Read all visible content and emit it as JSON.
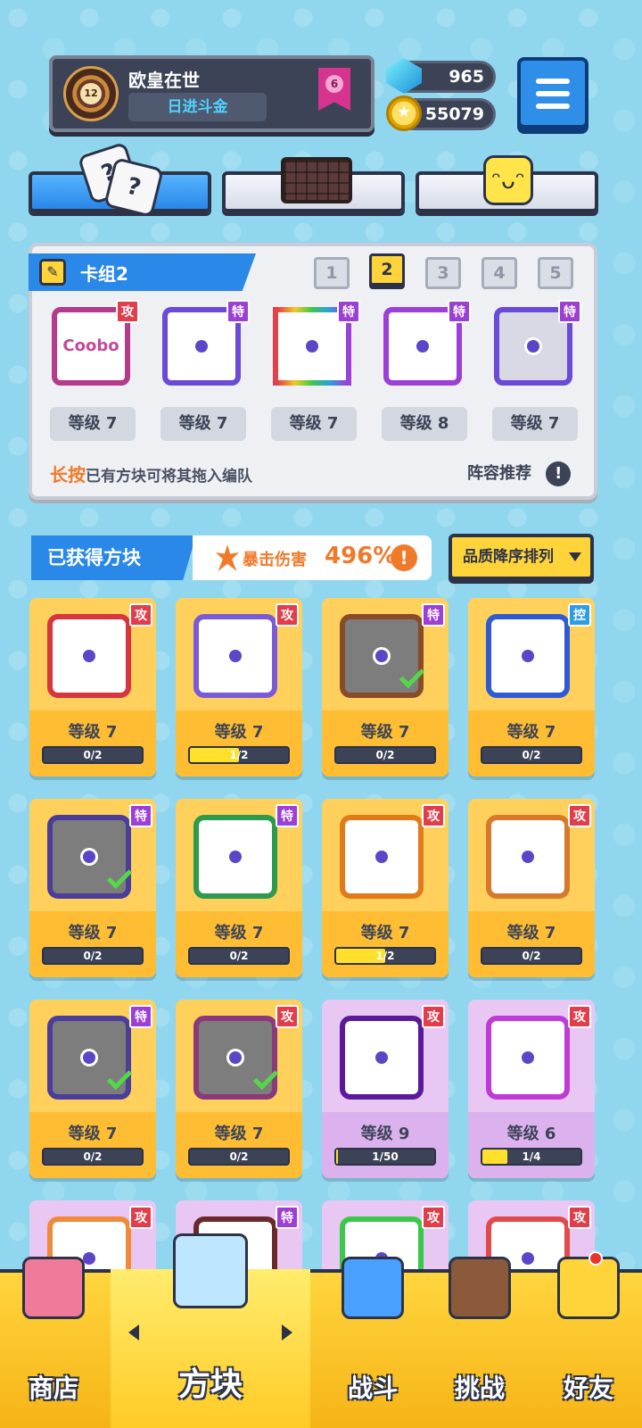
{
  "player": {
    "name": "欧皇在世",
    "title": "日进斗金",
    "rank_level": "12",
    "vip_level": "6"
  },
  "currency": {
    "gems": "965",
    "coins": "55079"
  },
  "icons": {
    "menu": "hamburger-menu-icon",
    "gem": "blue-gem-icon",
    "coin": "gold-coin-icon"
  },
  "top_tabs": [
    {
      "icon": "dice-icon",
      "active": true
    },
    {
      "icon": "grid-board-icon",
      "active": false
    },
    {
      "icon": "smiley-block-icon",
      "active": false
    }
  ],
  "deck": {
    "title": "卡组2",
    "pages": [
      "1",
      "2",
      "3",
      "4",
      "5"
    ],
    "active_page": "2",
    "cards": [
      {
        "tag": "攻",
        "level": "等级 7",
        "inner": "Coobo"
      },
      {
        "tag": "特",
        "level": "等级 7",
        "inner": ""
      },
      {
        "tag": "特",
        "level": "等级 7",
        "inner": ""
      },
      {
        "tag": "特",
        "level": "等级 8",
        "inner": ""
      },
      {
        "tag": "特",
        "level": "等级 7",
        "inner": ""
      }
    ],
    "hint_highlight": "长按",
    "hint_text": "已有方块可将其拖入编队",
    "recommend": "阵容推荐",
    "info": "!"
  },
  "owned": {
    "title": "已获得方块",
    "crit_label": "暴击伤害",
    "crit_value": "496%",
    "warn": "!",
    "sort_label": "品质降序排列",
    "cards": [
      {
        "tag": "攻",
        "level": "等级 7",
        "progress": "0/2",
        "fill": 0,
        "frame": "#d8353f",
        "style": "gold",
        "check": false
      },
      {
        "tag": "攻",
        "level": "等级 7",
        "progress": "1/2",
        "fill": 0.5,
        "frame": "#7a5ad6",
        "style": "gold",
        "check": false
      },
      {
        "tag": "特",
        "level": "等级 7",
        "progress": "0/2",
        "fill": 0,
        "frame": "#8a4b2a",
        "style": "gold",
        "check": true
      },
      {
        "tag": "控",
        "level": "等级 7",
        "progress": "0/2",
        "fill": 0,
        "frame": "#2f5ad6",
        "style": "gold",
        "check": false
      },
      {
        "tag": "特",
        "level": "等级 7",
        "progress": "0/2",
        "fill": 0,
        "frame": "#4a3e9a",
        "style": "gold",
        "check": true
      },
      {
        "tag": "特",
        "level": "等级 7",
        "progress": "0/2",
        "fill": 0,
        "frame": "#2e9a4e",
        "style": "gold",
        "check": false
      },
      {
        "tag": "攻",
        "level": "等级 7",
        "progress": "1/2",
        "fill": 0.5,
        "frame": "#e07a1a",
        "style": "gold",
        "check": false
      },
      {
        "tag": "攻",
        "level": "等级 7",
        "progress": "0/2",
        "fill": 0,
        "frame": "#d8782a",
        "style": "gold",
        "check": false
      },
      {
        "tag": "特",
        "level": "等级 7",
        "progress": "0/2",
        "fill": 0,
        "frame": "#4a3e9a",
        "style": "gold",
        "check": true
      },
      {
        "tag": "攻",
        "level": "等级 7",
        "progress": "0/2",
        "fill": 0,
        "frame": "#8a3a7a",
        "style": "gold",
        "check": true
      },
      {
        "tag": "攻",
        "level": "等级 9",
        "progress": "1/50",
        "fill": 0.02,
        "frame": "#5b1a9a",
        "style": "purple",
        "check": false
      },
      {
        "tag": "攻",
        "level": "等级 6",
        "progress": "1/4",
        "fill": 0.25,
        "frame": "#c03ad6",
        "style": "purple",
        "check": false
      },
      {
        "tag": "攻",
        "level": "",
        "progress": "",
        "fill": 0,
        "frame": "#f08a3a",
        "style": "purple",
        "check": false
      },
      {
        "tag": "特",
        "level": "",
        "progress": "",
        "fill": 0,
        "frame": "#6a2a2a",
        "style": "purple",
        "check": false
      },
      {
        "tag": "攻",
        "level": "",
        "progress": "",
        "fill": 0,
        "frame": "#3ac84a",
        "style": "purple",
        "check": false
      },
      {
        "tag": "攻",
        "level": "",
        "progress": "",
        "fill": 0,
        "frame": "#e04a4a",
        "style": "purple",
        "check": false
      }
    ]
  },
  "nav": {
    "shop": "商店",
    "blocks": "方块",
    "battle": "战斗",
    "challenge": "挑战",
    "friends": "好友"
  },
  "colors": {
    "background": "#8fd6ee",
    "accent_blue": "#2a88e8",
    "accent_yellow": "#ffd43a",
    "tag_attack": "#e23d4b",
    "tag_special": "#9c3fd6",
    "tag_control": "#2d9ee0"
  }
}
